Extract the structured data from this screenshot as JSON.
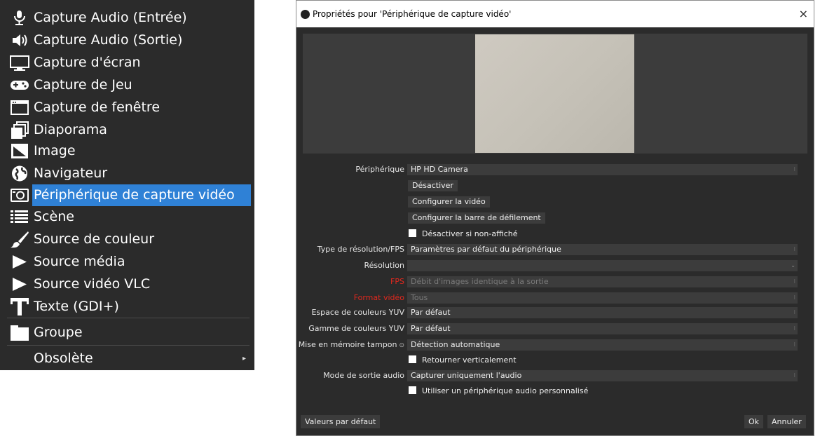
{
  "menu": {
    "items": [
      {
        "label": "Capture Audio (Entrée)",
        "icon": "microphone-icon"
      },
      {
        "label": "Capture Audio (Sortie)",
        "icon": "speaker-icon"
      },
      {
        "label": "Capture d'écran",
        "icon": "monitor-icon"
      },
      {
        "label": "Capture de Jeu",
        "icon": "gamepad-icon"
      },
      {
        "label": "Capture de fenêtre",
        "icon": "window-icon"
      },
      {
        "label": "Diaporama",
        "icon": "slideshow-icon"
      },
      {
        "label": "Image",
        "icon": "image-icon"
      },
      {
        "label": "Navigateur",
        "icon": "globe-icon"
      },
      {
        "label": "Périphérique de capture vidéo",
        "icon": "camera-icon"
      },
      {
        "label": "Scène",
        "icon": "list-icon"
      },
      {
        "label": "Source de couleur",
        "icon": "brush-icon"
      },
      {
        "label": "Source média",
        "icon": "play-icon"
      },
      {
        "label": "Source vidéo VLC",
        "icon": "play-icon"
      },
      {
        "label": "Texte (GDI+)",
        "icon": "text-icon"
      },
      {
        "label": "Groupe",
        "icon": "folder-icon"
      },
      {
        "label": "Obsolète",
        "icon": ""
      }
    ],
    "submenu_arrow": "▸",
    "selected_color": "#2f81d6"
  },
  "dialog": {
    "title": "Propriétés pour 'Périphérique de capture vidéo'",
    "close": "×",
    "device_label": "Périphérique",
    "device_value": "HP HD Camera",
    "btn_deactivate": "Désactiver",
    "btn_configure_video": "Configurer la vidéo",
    "btn_configure_crossbar": "Configurer la barre de défilement",
    "chk_deactivate_hidden": "Désactiver si non-affiché",
    "res_type_label": "Type de résolution/FPS",
    "res_type_value": "Paramètres par défaut du périphérique",
    "resolution_label": "Résolution",
    "resolution_value": "",
    "fps_label": "FPS",
    "fps_value": "Débit d'images identique à la sortie",
    "video_format_label": "Format vidéo",
    "video_format_value": "Tous",
    "yuv_space_label": "Espace de couleurs YUV",
    "yuv_space_value": "Par défaut",
    "yuv_range_label": "Gamme de couleurs YUV",
    "yuv_range_value": "Par défaut",
    "buffering_label": "Mise en mémoire tampon",
    "buffering_value": "Détection automatique",
    "chk_flip": "Retourner verticalement",
    "audio_mode_label": "Mode de sortie audio",
    "audio_mode_value": "Capturer uniquement l'audio",
    "chk_custom_audio": "Utiliser un périphérique audio personnalisé",
    "btn_defaults": "Valeurs par défaut",
    "btn_ok": "Ok",
    "btn_cancel": "Annuler",
    "warn_color": "#e0281e"
  }
}
